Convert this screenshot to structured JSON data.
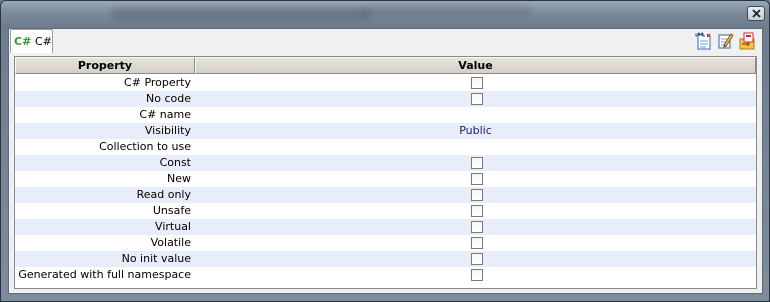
{
  "tab": {
    "icon_text": "C#",
    "label": "C#"
  },
  "toolbar": {
    "icons": [
      "uml-document-icon",
      "edit-note-icon",
      "export-icon"
    ]
  },
  "grid": {
    "columns": [
      "Property",
      "Value"
    ],
    "rows": [
      {
        "property": "C# Property",
        "type": "checkbox",
        "checked": false
      },
      {
        "property": "No code",
        "type": "checkbox",
        "checked": false
      },
      {
        "property": "C# name",
        "type": "text",
        "value": ""
      },
      {
        "property": "Visibility",
        "type": "text",
        "value": "Public"
      },
      {
        "property": "Collection to use",
        "type": "text",
        "value": ""
      },
      {
        "property": "Const",
        "type": "checkbox",
        "checked": false
      },
      {
        "property": "New",
        "type": "checkbox",
        "checked": false
      },
      {
        "property": "Read only",
        "type": "checkbox",
        "checked": false
      },
      {
        "property": "Unsafe",
        "type": "checkbox",
        "checked": false
      },
      {
        "property": "Virtual",
        "type": "checkbox",
        "checked": false
      },
      {
        "property": "Volatile",
        "type": "checkbox",
        "checked": false
      },
      {
        "property": "No init value",
        "type": "checkbox",
        "checked": false
      },
      {
        "property": "Generated with full namespace",
        "type": "checkbox",
        "checked": false
      }
    ]
  }
}
